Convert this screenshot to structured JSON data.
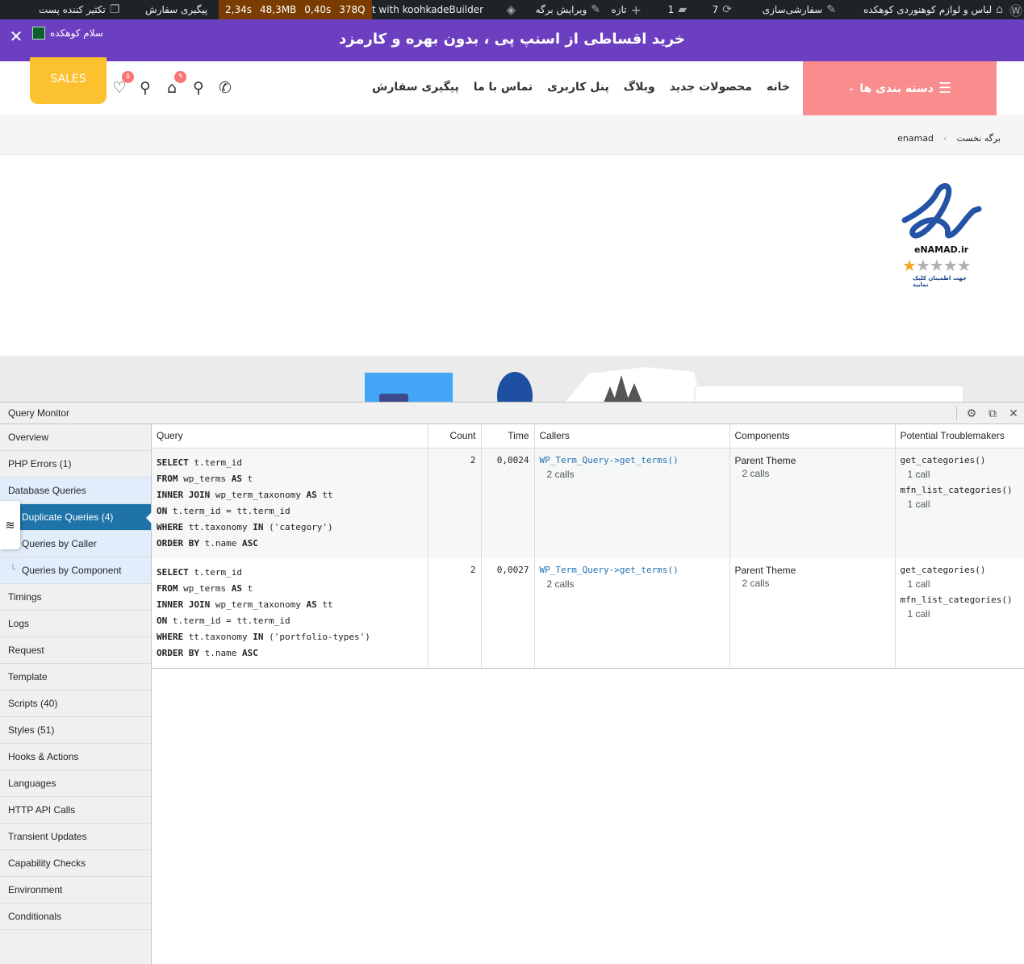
{
  "admin_bar": {
    "site_name": "لباس و لوازم کوهنوردی کوهکده",
    "customize": "سفارشی‌سازی",
    "updates": "7",
    "comments": "1",
    "new": "تازه",
    "edit_page": "ویرایش برگه",
    "builder": "Edit with koohkadeBuilder",
    "qm_time": "2,34s",
    "qm_memory": "48,3MB",
    "qm_db_time": "0,40s",
    "qm_queries": "378Q",
    "order_tracking": "پیگیری سفارش",
    "duplicator": "تکثیر کننده پست"
  },
  "promo": {
    "text": "خرید اقساطی از اسنپ پی ، بدون بهره و کارمزد",
    "greeting": "سلام کوهکده"
  },
  "header": {
    "category_button": "دسته بندی ها",
    "nav": [
      "خانه",
      "محصولات جدید",
      "وبلاگ",
      "پنل کاربری",
      "تماس با ما",
      "پیگیری سفارش"
    ],
    "sales_button": "SALES",
    "cart_count": "۹",
    "wishlist_count": "۵"
  },
  "breadcrumb": {
    "home": "برگه نخست",
    "separator": "‹",
    "current": "enamad"
  },
  "enamad": {
    "brand": "eNAMAD.ir",
    "caption": "جهت اطمینان کلیک نمایید",
    "rating": 1,
    "max_rating": 5
  },
  "query_monitor": {
    "title": "Query Monitor",
    "sidebar": [
      {
        "label": "Overview",
        "type": "item"
      },
      {
        "label": "PHP Errors (1)",
        "type": "item"
      },
      {
        "label": "Database Queries",
        "type": "parent"
      },
      {
        "label": "Duplicate Queries (4)",
        "type": "active"
      },
      {
        "label": "Queries by Caller",
        "type": "sub"
      },
      {
        "label": "Queries by Component",
        "type": "sub"
      },
      {
        "label": "Timings",
        "type": "item"
      },
      {
        "label": "Logs",
        "type": "item"
      },
      {
        "label": "Request",
        "type": "item"
      },
      {
        "label": "Template",
        "type": "item"
      },
      {
        "label": "Scripts (40)",
        "type": "item"
      },
      {
        "label": "Styles (51)",
        "type": "item"
      },
      {
        "label": "Hooks & Actions",
        "type": "item"
      },
      {
        "label": "Languages",
        "type": "item"
      },
      {
        "label": "HTTP API Calls",
        "type": "item"
      },
      {
        "label": "Transient Updates",
        "type": "item"
      },
      {
        "label": "Capability Checks",
        "type": "item"
      },
      {
        "label": "Environment",
        "type": "item"
      },
      {
        "label": "Conditionals",
        "type": "item"
      }
    ],
    "columns": {
      "query": "Query",
      "count": "Count",
      "time": "Time",
      "callers": "Callers",
      "components": "Components",
      "troublemakers": "Potential Troublemakers"
    },
    "rows": [
      {
        "sql": [
          {
            "kw": "SELECT",
            "rest": " t.term_id"
          },
          {
            "kw": "FROM",
            "rest": " wp_terms ",
            "kw2": "AS",
            "rest2": " t"
          },
          {
            "kw": "INNER JOIN",
            "rest": " wp_term_taxonomy ",
            "kw2": "AS",
            "rest2": " tt"
          },
          {
            "kw": "ON",
            "rest": " t.term_id = tt.term_id"
          },
          {
            "kw": "WHERE",
            "rest": " tt.taxonomy ",
            "kw2": "IN",
            "rest2": " ('category')"
          },
          {
            "kw": "ORDER BY",
            "rest": " t.name ",
            "kw2": "ASC",
            "rest2": ""
          }
        ],
        "count": "2",
        "time": "0,0024",
        "caller": "WP_Term_Query->get_terms()",
        "caller_calls": "2 calls",
        "component": "Parent Theme",
        "component_calls": "2 calls",
        "troublemakers": [
          {
            "fn": "get_categories()",
            "calls": "1 call"
          },
          {
            "fn": "mfn_list_categories()",
            "calls": "1 call"
          }
        ]
      },
      {
        "sql": [
          {
            "kw": "SELECT",
            "rest": " t.term_id"
          },
          {
            "kw": "FROM",
            "rest": " wp_terms ",
            "kw2": "AS",
            "rest2": " t"
          },
          {
            "kw": "INNER JOIN",
            "rest": " wp_term_taxonomy ",
            "kw2": "AS",
            "rest2": " tt"
          },
          {
            "kw": "ON",
            "rest": " t.term_id = tt.term_id"
          },
          {
            "kw": "WHERE",
            "rest": " tt.taxonomy ",
            "kw2": "IN",
            "rest2": " ('portfolio-types')"
          },
          {
            "kw": "ORDER BY",
            "rest": " t.name ",
            "kw2": "ASC",
            "rest2": ""
          }
        ],
        "count": "2",
        "time": "0,0027",
        "caller": "WP_Term_Query->get_terms()",
        "caller_calls": "2 calls",
        "component": "Parent Theme",
        "component_calls": "2 calls",
        "troublemakers": [
          {
            "fn": "get_categories()",
            "calls": "1 call"
          },
          {
            "fn": "mfn_list_categories()",
            "calls": "1 call"
          }
        ]
      }
    ]
  },
  "colors": {
    "admin_bar": "#1d2327",
    "promo": "#6c3fc1",
    "category_button": "#f98c8c",
    "sales_button": "#fcc12e",
    "qm_active": "#1e73a9",
    "badge": "#f97474"
  }
}
